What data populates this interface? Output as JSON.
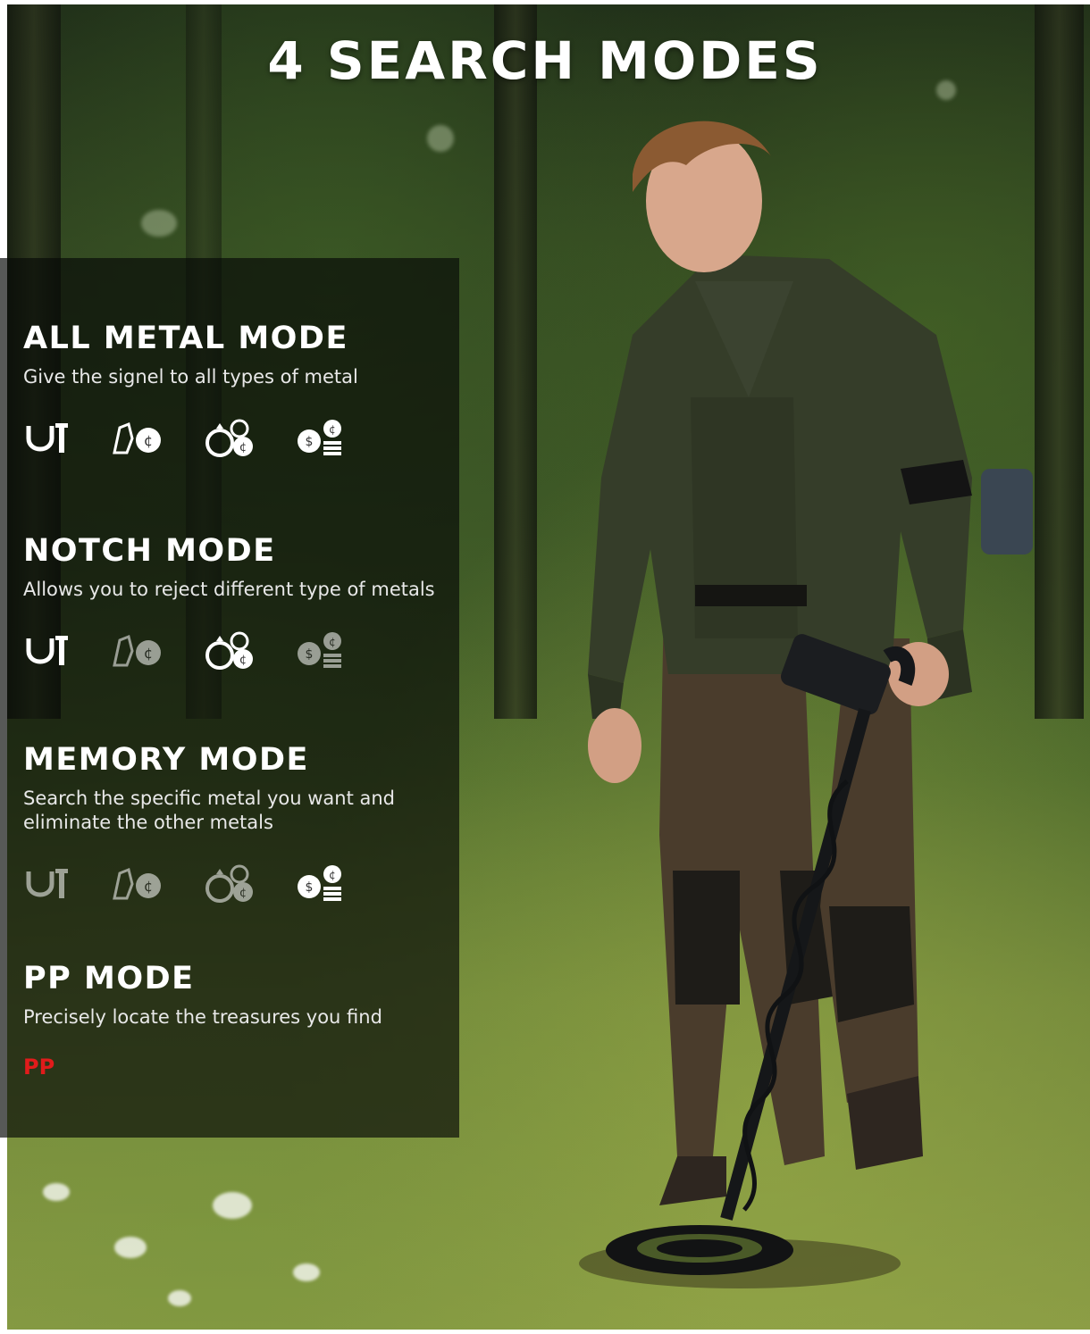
{
  "title": "4 SEARCH MODES",
  "modes": [
    {
      "name": "ALL METAL MODE",
      "description": "Give the signel to all types of metal",
      "icons": [
        {
          "name": "horseshoe-nail-icon",
          "active": true
        },
        {
          "name": "relic-coin-icon",
          "active": true
        },
        {
          "name": "rings-icon",
          "active": true
        },
        {
          "name": "coins-stack-icon",
          "active": true
        }
      ]
    },
    {
      "name": "NOTCH MODE",
      "description": "Allows you to reject different type of metals",
      "icons": [
        {
          "name": "horseshoe-nail-icon",
          "active": true
        },
        {
          "name": "relic-coin-icon",
          "active": false
        },
        {
          "name": "rings-icon",
          "active": true
        },
        {
          "name": "coins-stack-icon",
          "active": false
        }
      ]
    },
    {
      "name": "MEMORY MODE",
      "description": "Search the specific metal you want and eliminate the other metals",
      "icons": [
        {
          "name": "horseshoe-nail-icon",
          "active": false
        },
        {
          "name": "relic-coin-icon",
          "active": false
        },
        {
          "name": "rings-icon",
          "active": false
        },
        {
          "name": "coins-stack-icon",
          "active": true
        }
      ]
    },
    {
      "name": "PP MODE",
      "description": "Precisely locate the treasures you find",
      "badge": "PP"
    }
  ],
  "colors": {
    "panel": "#080a08",
    "badge": "#e11b1b",
    "text": "#ffffff"
  }
}
